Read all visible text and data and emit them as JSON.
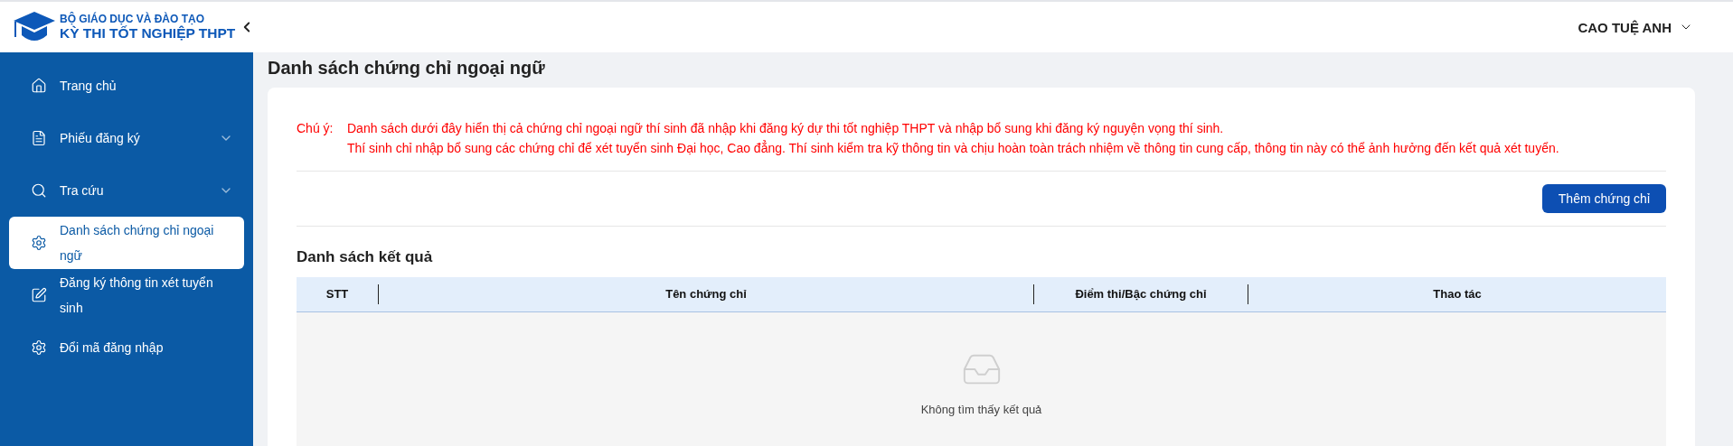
{
  "header": {
    "org": "BỘ GIÁO DỤC VÀ ĐÀO TẠO",
    "title": "KỲ THI TỐT NGHIỆP THPT",
    "user": "CAO TUỆ ANH"
  },
  "sidebar": {
    "items": [
      {
        "label": "Trang chủ",
        "kind": "link",
        "selected": false
      },
      {
        "label": "Phiếu đăng ký",
        "kind": "group",
        "expanded": false,
        "selected": false
      },
      {
        "label": "Tra cứu",
        "kind": "group",
        "expanded": false,
        "selected": false
      },
      {
        "label": "Danh sách chứng chỉ ngoại ngữ",
        "kind": "link",
        "selected": true
      },
      {
        "label": "Đăng ký thông tin xét tuyển sinh",
        "kind": "link",
        "selected": false
      },
      {
        "label": "Đổi mã đăng nhập",
        "kind": "link",
        "selected": false
      }
    ]
  },
  "page_title": "Danh sách chứng chỉ ngoại ngữ",
  "notice": {
    "label": "Chú ý:",
    "lines": [
      "Danh sách dưới đây hiển thị cả chứng chỉ ngoại ngữ thí sinh đã nhập khi đăng ký dự thi tốt nghiệp THPT và nhập bổ sung khi đăng ký nguyện vọng thí sinh.",
      "Thí sinh chỉ nhập bổ sung các chứng chỉ để xét tuyển sinh Đại học, Cao đẳng. Thí sinh kiểm tra kỹ thông tin và chịu hoàn toàn trách nhiệm về thông tin cung cấp, thông tin này có thể ảnh hưởng đến kết quả xét tuyển."
    ]
  },
  "add_button": "Thêm chứng chỉ",
  "results": {
    "title": "Danh sách kết quả",
    "columns": [
      "STT",
      "Tên chứng chỉ",
      "Điểm thi/Bậc chứng chỉ",
      "Thao tác"
    ],
    "empty_text": "Không tìm thấy kết quả"
  }
}
